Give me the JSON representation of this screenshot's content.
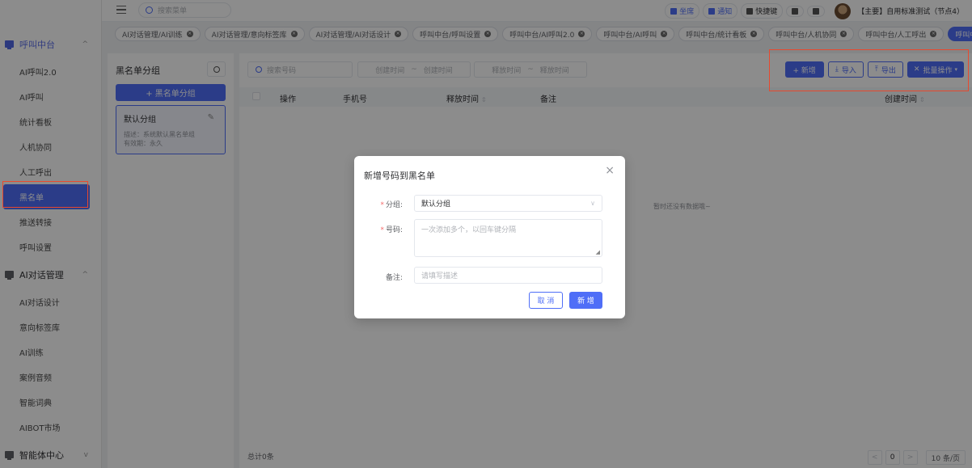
{
  "topbar": {
    "search_placeholder": "搜索菜单",
    "actions": [
      {
        "label": "坐席",
        "icon": "headset-icon"
      },
      {
        "label": "通知",
        "icon": "bell-icon"
      },
      {
        "label": "快捷键",
        "icon": "keyboard-icon"
      }
    ],
    "user_label": "【主要】自用标准测试（节点4）"
  },
  "tabs": [
    {
      "label": "AI对话管理/AI训练",
      "active": false
    },
    {
      "label": "AI对话管理/意向标签库",
      "active": false
    },
    {
      "label": "AI对话管理/AI对话设计",
      "active": false
    },
    {
      "label": "呼叫中台/呼叫设置",
      "active": false
    },
    {
      "label": "呼叫中台/AI呼叫2.0",
      "active": false
    },
    {
      "label": "呼叫中台/AI呼叫",
      "active": false
    },
    {
      "label": "呼叫中台/统计看板",
      "active": false
    },
    {
      "label": "呼叫中台/人机协同",
      "active": false
    },
    {
      "label": "呼叫中台/人工呼出",
      "active": false
    },
    {
      "label": "呼叫中台",
      "active": true
    }
  ],
  "sidebar": {
    "group1": {
      "label": "呼叫中台",
      "chevron": "^"
    },
    "group1_items": [
      "AI呼叫2.0",
      "AI呼叫",
      "统计看板",
      "人机协同",
      "人工呼出",
      "黑名单",
      "推送转接",
      "呼叫设置"
    ],
    "group2": {
      "label": "AI对话管理",
      "chevron": "^"
    },
    "group2_items": [
      "AI对话设计",
      "意向标签库",
      "AI训练",
      "案例音频",
      "智能词典",
      "AIBOT市场"
    ],
    "group3": {
      "label": "智能体中心",
      "chevron": "v"
    }
  },
  "group_panel": {
    "title": "黑名单分组",
    "add_button": "+ 黑名单分组",
    "card": {
      "name": "默认分组",
      "desc": "描述：系统默认黑名单组",
      "valid": "有效期：永久"
    }
  },
  "list": {
    "search_placeholder": "搜索号码",
    "create_start": "创建时间",
    "create_end": "创建时间",
    "release_start": "释放时间",
    "release_end": "释放时间",
    "range_sep": "~",
    "toolbar": {
      "add": "+ 新增",
      "import": "导入",
      "export": "导出",
      "batch": "批量操作"
    },
    "columns": [
      "操作",
      "手机号",
      "释放时间",
      "备注",
      "创建时间"
    ],
    "sort_glyph": "⇕",
    "empty_text": "暂时还没有数据哦~",
    "total": "总计0条",
    "pagination": {
      "prev": "<",
      "page": "0",
      "next": ">",
      "page_size": "10 条/页"
    }
  },
  "dialog": {
    "title": "新增号码到黑名单",
    "close": "×",
    "group_label": "分组:",
    "group_value": "默认分组",
    "number_label": "号码:",
    "number_placeholder": "一次添加多个，以回车键分隔",
    "remark_label": "备注:",
    "remark_placeholder": "请填写描述",
    "cancel": "取 消",
    "submit": "新 增"
  },
  "colors": {
    "accent": "#4f6ef7",
    "highlight": "#e8492e",
    "required": "#f56c6c"
  }
}
